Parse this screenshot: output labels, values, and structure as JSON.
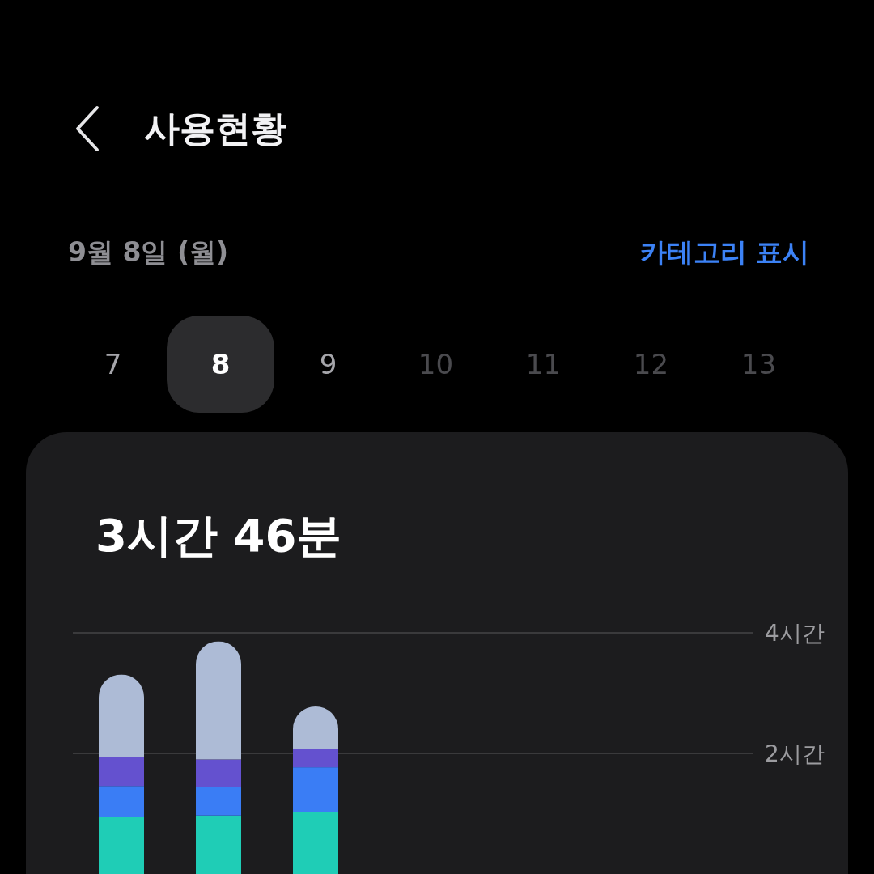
{
  "header": {
    "title": "사용현황"
  },
  "date_bar": {
    "date": "9월 8일 (월)",
    "action": "카테고리 표시"
  },
  "days": [
    {
      "label": "7",
      "selected": false,
      "disabled": false
    },
    {
      "label": "8",
      "selected": true,
      "disabled": false
    },
    {
      "label": "9",
      "selected": false,
      "disabled": false
    },
    {
      "label": "10",
      "selected": false,
      "disabled": true
    },
    {
      "label": "11",
      "selected": false,
      "disabled": true
    },
    {
      "label": "12",
      "selected": false,
      "disabled": true
    },
    {
      "label": "13",
      "selected": false,
      "disabled": true
    }
  ],
  "summary": {
    "total": "3시간 46분",
    "chart_data": {
      "type": "bar",
      "stacked": true,
      "ylim": [
        0,
        4
      ],
      "yticks": [
        {
          "value": 2,
          "label": "2시간"
        },
        {
          "value": 4,
          "label": "4시간"
        }
      ],
      "series": [
        {
          "color": "#1fcdb6",
          "values": [
            0.94,
            0.97,
            1.03,
            null,
            null,
            null,
            null
          ]
        },
        {
          "color": "#3a7df5",
          "values": [
            0.52,
            0.47,
            0.74,
            null,
            null,
            null,
            null
          ]
        },
        {
          "color": "#6451cf",
          "values": [
            0.48,
            0.46,
            0.31,
            null,
            null,
            null,
            null
          ]
        },
        {
          "color": "#adbbd6",
          "values": [
            1.37,
            1.96,
            0.7,
            null,
            null,
            null,
            null
          ]
        }
      ]
    }
  }
}
